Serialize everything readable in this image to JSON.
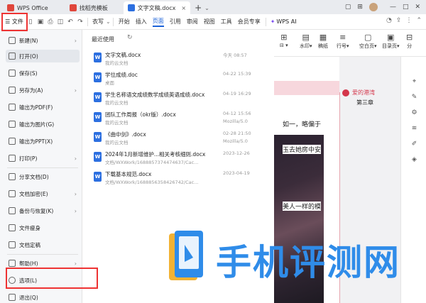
{
  "titlebar": {
    "tabs": [
      {
        "label": "WPS Office",
        "icon": "wps-logo-icon",
        "color": "#e0463b"
      },
      {
        "label": "找稻壳模板",
        "icon": "docer-icon",
        "color": "#e0463b"
      },
      {
        "label": "文字文稿.docx",
        "icon": "word-doc-icon",
        "color": "#2c6fe0"
      }
    ],
    "close": "×",
    "plus": "+"
  },
  "ribbon": {
    "file_label": "☰ 文件",
    "font_value": "衣写",
    "menu": [
      "开始",
      "插入",
      "页面",
      "引用",
      "审阅",
      "视图",
      "工具",
      "会员专享"
    ],
    "active_menu": "页面",
    "wps_ai": "WPS AI"
  },
  "docbar": {
    "groups": [
      {
        "glyph": "⊞",
        "label": "⊟ ▾"
      },
      {
        "glyph": "▤",
        "label": "水印▾"
      },
      {
        "glyph": "▦",
        "label": "稿纸"
      },
      {
        "glyph": "≡",
        "label": "行号▾"
      },
      {
        "glyph": "▢",
        "label": "空白页▾"
      },
      {
        "glyph": "▣",
        "label": "目录页▾"
      },
      {
        "glyph": "⊟",
        "label": "分"
      }
    ]
  },
  "file_menu": {
    "items": [
      {
        "label": "新建(N)",
        "arrow": true
      },
      {
        "label": "打开(O)",
        "arrow": false
      },
      {
        "label": "保存(S)",
        "arrow": false
      },
      {
        "label": "另存为(A)",
        "arrow": true
      },
      {
        "label": "输出为PDF(F)",
        "arrow": false
      },
      {
        "label": "输出为图片(G)",
        "arrow": false
      },
      {
        "label": "输出为PPT(X)",
        "arrow": false
      },
      {
        "label": "打印(P)",
        "arrow": true
      },
      {
        "label": "分享文档(D)",
        "arrow": false
      },
      {
        "label": "文档加密(E)",
        "arrow": true
      },
      {
        "label": "备份与恢复(K)",
        "arrow": true
      },
      {
        "label": "文件瘦身",
        "arrow": false
      },
      {
        "label": "文档定稿",
        "arrow": false
      },
      {
        "label": "帮助(H)",
        "arrow": true
      },
      {
        "label": "选项(L)",
        "arrow": false
      },
      {
        "label": "退出(Q)",
        "arrow": false
      }
    ]
  },
  "recent": {
    "title": "最近使用",
    "files": [
      {
        "name": "文字文稿.docx",
        "path": "我的云文档",
        "time": "今天 08:57",
        "source": ""
      },
      {
        "name": "学位成绩.doc",
        "path": "桌面",
        "time": "04-22 15:39",
        "source": ""
      },
      {
        "name": "学生名称语文成绩数学成绩英语成绩.docx",
        "path": "我的云文档",
        "time": "04-19 16:29",
        "source": ""
      },
      {
        "name": "团队工作周报（okr版）.docx",
        "path": "我的云文档",
        "time": "04-12 15:56",
        "source": "Mozilla/5.0"
      },
      {
        "name": "《曲中剑》.docx",
        "path": "我的云文档",
        "time": "02-28 21:50",
        "source": "Mozilla/5.0"
      },
      {
        "name": "2024年1月新增维护...相关考核细则.docx",
        "path": "文档/WXWork/1688857374474637/Cac...",
        "time": "2023-12-26",
        "source": ""
      },
      {
        "name": "下载基本规范.docx",
        "path": "文档/WXWork/1688856358426742/Cac...",
        "time": "2023-04-19",
        "source": ""
      }
    ]
  },
  "document": {
    "snippets": [
      "如一，略偏于",
      "玉去她房中安",
      "美人一样的模"
    ],
    "comment_author": "爱的港湾",
    "comment_body": "第三章"
  },
  "watermark": {
    "text": "手机评测网"
  },
  "colors": {
    "accent": "#1b62d8",
    "highlight": "#e33333",
    "watermark": "#2f8ce9",
    "comment": "#d4364b"
  }
}
